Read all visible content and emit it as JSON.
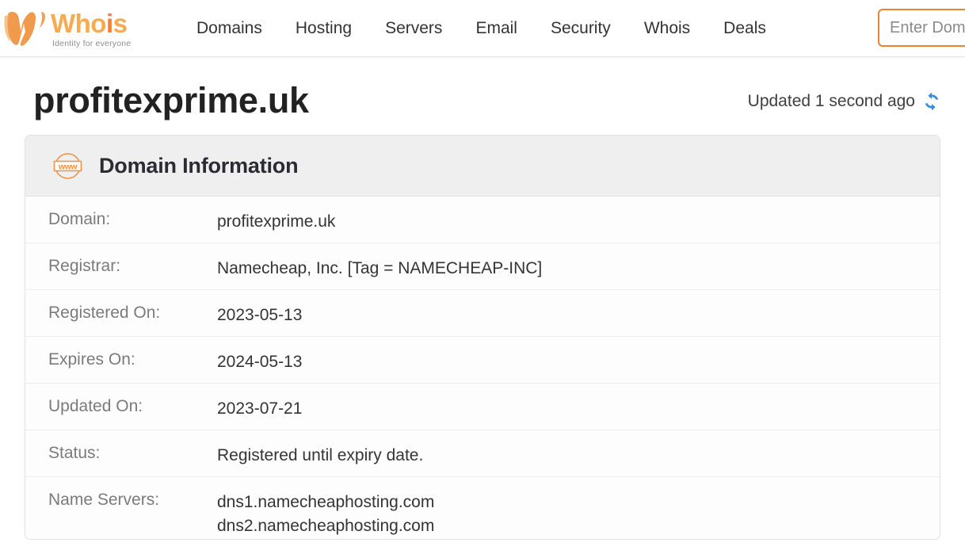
{
  "brand": {
    "word_part1": "Who",
    "word_part2": "i",
    "word_part3": "s",
    "tagline": "Identity for everyone",
    "logo_icon": "whois-swoosh-logo",
    "colors": {
      "word": "#f6ab52",
      "accent": "#ee7f3c"
    }
  },
  "nav": {
    "items": [
      {
        "label": "Domains"
      },
      {
        "label": "Hosting"
      },
      {
        "label": "Servers"
      },
      {
        "label": "Email"
      },
      {
        "label": "Security"
      },
      {
        "label": "Whois"
      },
      {
        "label": "Deals"
      }
    ],
    "search": {
      "placeholder": "Enter Domain Name",
      "value": "",
      "border_color": "#ea8433"
    }
  },
  "page": {
    "title": "profitexprime.uk",
    "updated_text": "Updated 1 second ago",
    "refresh_icon": "refresh-icon",
    "refresh_icon_color": "#3b8fd6"
  },
  "panel": {
    "icon": "www-badge-icon",
    "icon_color": "#e8954f",
    "title": "Domain Information",
    "rows": [
      {
        "label": "Domain:",
        "value": "profitexprime.uk"
      },
      {
        "label": "Registrar:",
        "value": "Namecheap, Inc. [Tag = NAMECHEAP-INC]"
      },
      {
        "label": "Registered On:",
        "value": "2023-05-13"
      },
      {
        "label": "Expires On:",
        "value": "2024-05-13"
      },
      {
        "label": "Updated On:",
        "value": "2023-07-21"
      },
      {
        "label": "Status:",
        "value": "Registered until expiry date."
      }
    ],
    "name_servers": {
      "label": "Name Servers:",
      "values": [
        "dns1.namecheaphosting.com",
        "dns2.namecheaphosting.com"
      ]
    }
  }
}
